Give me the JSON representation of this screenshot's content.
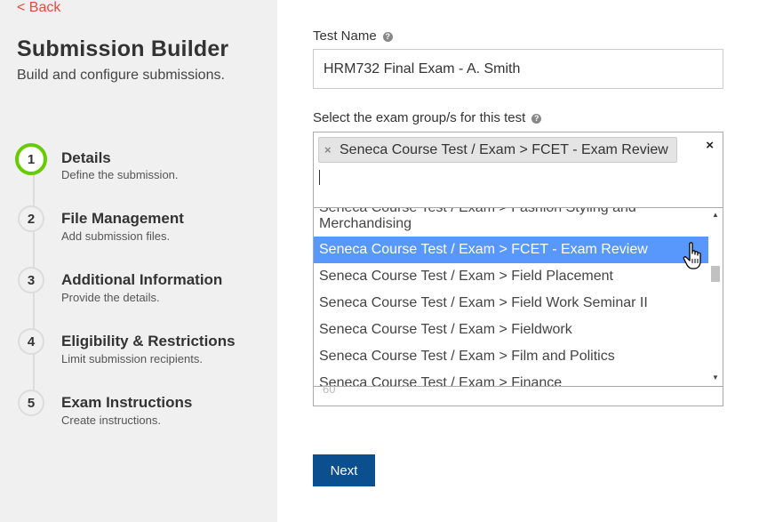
{
  "sidebar": {
    "back_label": "< Back",
    "title": "Submission Builder",
    "subtitle": "Build and configure submissions.",
    "steps": [
      {
        "number": "1",
        "title": "Details",
        "description": "Define the submission."
      },
      {
        "number": "2",
        "title": "File Management",
        "description": "Add submission files."
      },
      {
        "number": "3",
        "title": "Additional Information",
        "description": "Provide the details."
      },
      {
        "number": "4",
        "title": "Eligibility & Restrictions",
        "description": "Limit submission recipients."
      },
      {
        "number": "5",
        "title": "Exam Instructions",
        "description": "Create instructions."
      }
    ],
    "active_step": 1,
    "active_color": "#66cc00"
  },
  "form": {
    "test_name_label": "Test Name",
    "test_name_value": "HRM732 Final Exam - A. Smith",
    "groups_label": "Select the exam group/s for this test",
    "selected_chip": "Seneca Course Test / Exam > FCET - Exam Review",
    "chip_remove": "×",
    "clear_all": "×",
    "help_icon": "?",
    "dropdown_options": [
      "Seneca Course Test / Exam > Fashion Styling and Merchandising",
      "Seneca Course Test / Exam > FCET - Exam Review",
      "Seneca Course Test / Exam > Field Placement",
      "Seneca Course Test / Exam > Field Work Seminar II",
      "Seneca Course Test / Exam > Fieldwork",
      "Seneca Course Test / Exam > Film and Politics",
      "Seneca Course Test / Exam > Finance"
    ],
    "highlighted_option": "Seneca Course Test / Exam > FCET - Exam Review",
    "faded_number": "60",
    "next_label": "Next"
  },
  "colors": {
    "accent": "#e8473d",
    "highlight": "#5897fb",
    "button": "#0b4f8f"
  }
}
